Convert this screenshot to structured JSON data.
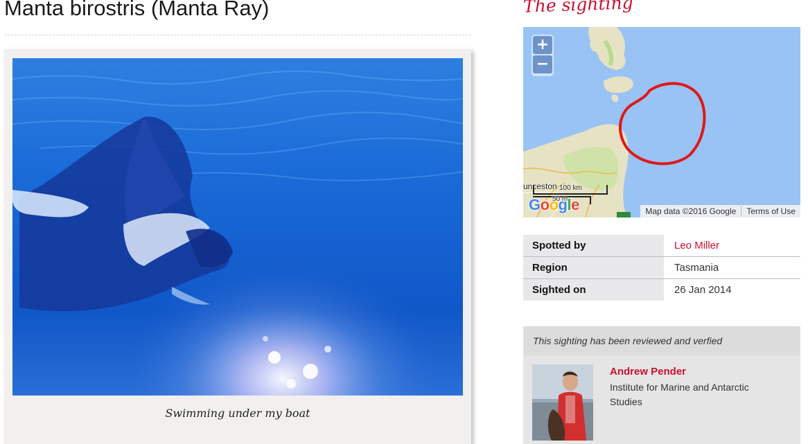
{
  "page": {
    "title": "Manta birostris (Manta Ray)"
  },
  "photo": {
    "caption": "Swimming under my boat"
  },
  "sighting": {
    "heading": "The sighting",
    "map": {
      "zoom_in": "+",
      "zoom_out": "−",
      "city_label": "unceston",
      "scale_km": "100 km",
      "scale_m": "50 m",
      "logo": "Google",
      "map_data": "Map data ©2016 Google",
      "terms": "Terms of Use"
    },
    "details": [
      {
        "label": "Spotted by",
        "value": "Leo Miller"
      },
      {
        "label": "Region",
        "value": "Tasmania"
      },
      {
        "label": "Sighted on",
        "value": "26 Jan 2014"
      }
    ]
  },
  "review": {
    "status": "This sighting has been reviewed and verfied",
    "reviewer_name": "Andrew Pender",
    "reviewer_org": "Institute for Marine and Antarctic Studies"
  },
  "colors": {
    "accent": "#c8102e",
    "ocean": "#99c3f5",
    "land": "#e6e2c4"
  }
}
